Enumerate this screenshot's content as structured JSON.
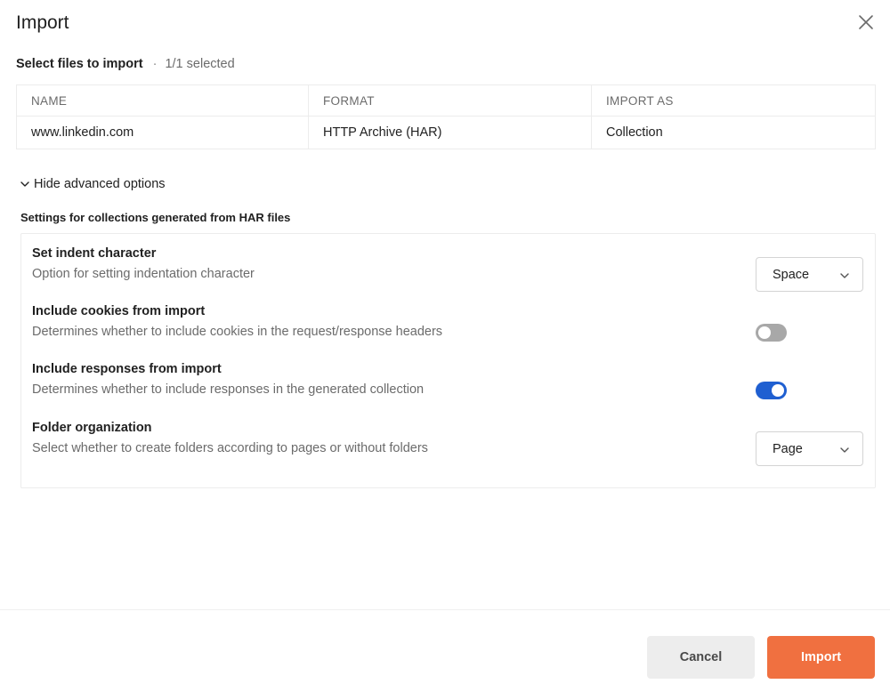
{
  "dialog": {
    "title": "Import"
  },
  "files": {
    "label": "Select files to import",
    "separator": "·",
    "count": "1/1 selected",
    "columns": [
      "NAME",
      "FORMAT",
      "IMPORT AS"
    ],
    "rows": [
      [
        "www.linkedin.com",
        "HTTP Archive (HAR)",
        "Collection"
      ]
    ]
  },
  "advanced": {
    "toggle_label": "Hide advanced options",
    "heading": "Settings for collections generated from HAR files",
    "settings": [
      {
        "title": "Set indent character",
        "description": "Option for setting indentation character",
        "control": "select",
        "value": "Space"
      },
      {
        "title": "Include cookies from import",
        "description": "Determines whether to include cookies in the request/response headers",
        "control": "toggle",
        "value": "off"
      },
      {
        "title": "Include responses from import",
        "description": "Determines whether to include responses in the generated collection",
        "control": "toggle",
        "value": "on"
      },
      {
        "title": "Folder organization",
        "description": "Select whether to create folders according to pages or without folders",
        "control": "select",
        "value": "Page"
      }
    ]
  },
  "footer": {
    "cancel_label": "Cancel",
    "import_label": "Import"
  },
  "colors": {
    "accent": "#f07040",
    "toggle_on": "#1f5fd1",
    "toggle_off": "#a8a8a8"
  },
  "icons": {
    "close": "close-icon",
    "chevron": "chevron-down-icon"
  }
}
